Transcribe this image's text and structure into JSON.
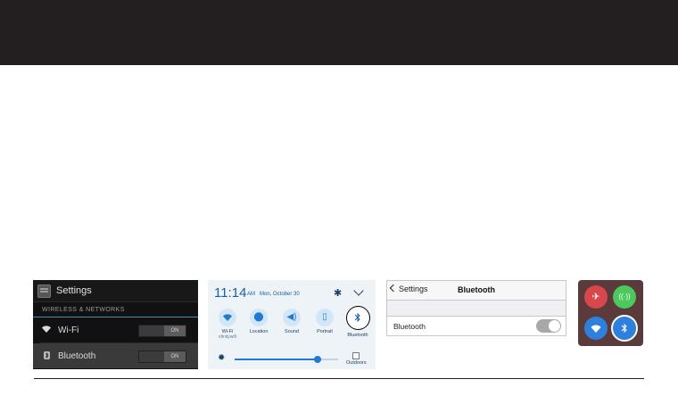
{
  "panel_android": {
    "title": "Settings",
    "section": "WIRELESS & NETWORKS",
    "rows": [
      {
        "label": "Wi-Fi",
        "toggle": "ON",
        "icon": "wifi-icon"
      },
      {
        "label": "Bluetooth",
        "toggle": "ON",
        "icon": "bluetooth-icon"
      }
    ]
  },
  "panel_samsung": {
    "time": "11:14",
    "ampm": "AM",
    "date": "Mon, October 30",
    "tiles": [
      {
        "label": "Wi-Fi",
        "sub": "xfinitywifi",
        "icon": "wifi-icon"
      },
      {
        "label": "Location",
        "sub": "",
        "icon": "location-icon"
      },
      {
        "label": "Sound",
        "sub": "",
        "icon": "sound-icon"
      },
      {
        "label": "Portrait",
        "sub": "",
        "icon": "portrait-icon"
      },
      {
        "label": "Bluetooth",
        "sub": "",
        "icon": "bluetooth-icon"
      }
    ],
    "brightness": 0.8,
    "outdoors_label": "Outdoors"
  },
  "panel_ios": {
    "back_label": "Settings",
    "title": "Bluetooth",
    "row_label": "Bluetooth",
    "toggle_on": false
  },
  "panel_cc": {
    "buttons": [
      {
        "icon": "airplane-icon",
        "color": "#d8474b"
      },
      {
        "icon": "cellular-icon",
        "color": "#4bc85e"
      },
      {
        "icon": "wifi-icon",
        "color": "#2f80dd"
      },
      {
        "icon": "bluetooth-icon",
        "color": "#2f80dd"
      }
    ]
  }
}
